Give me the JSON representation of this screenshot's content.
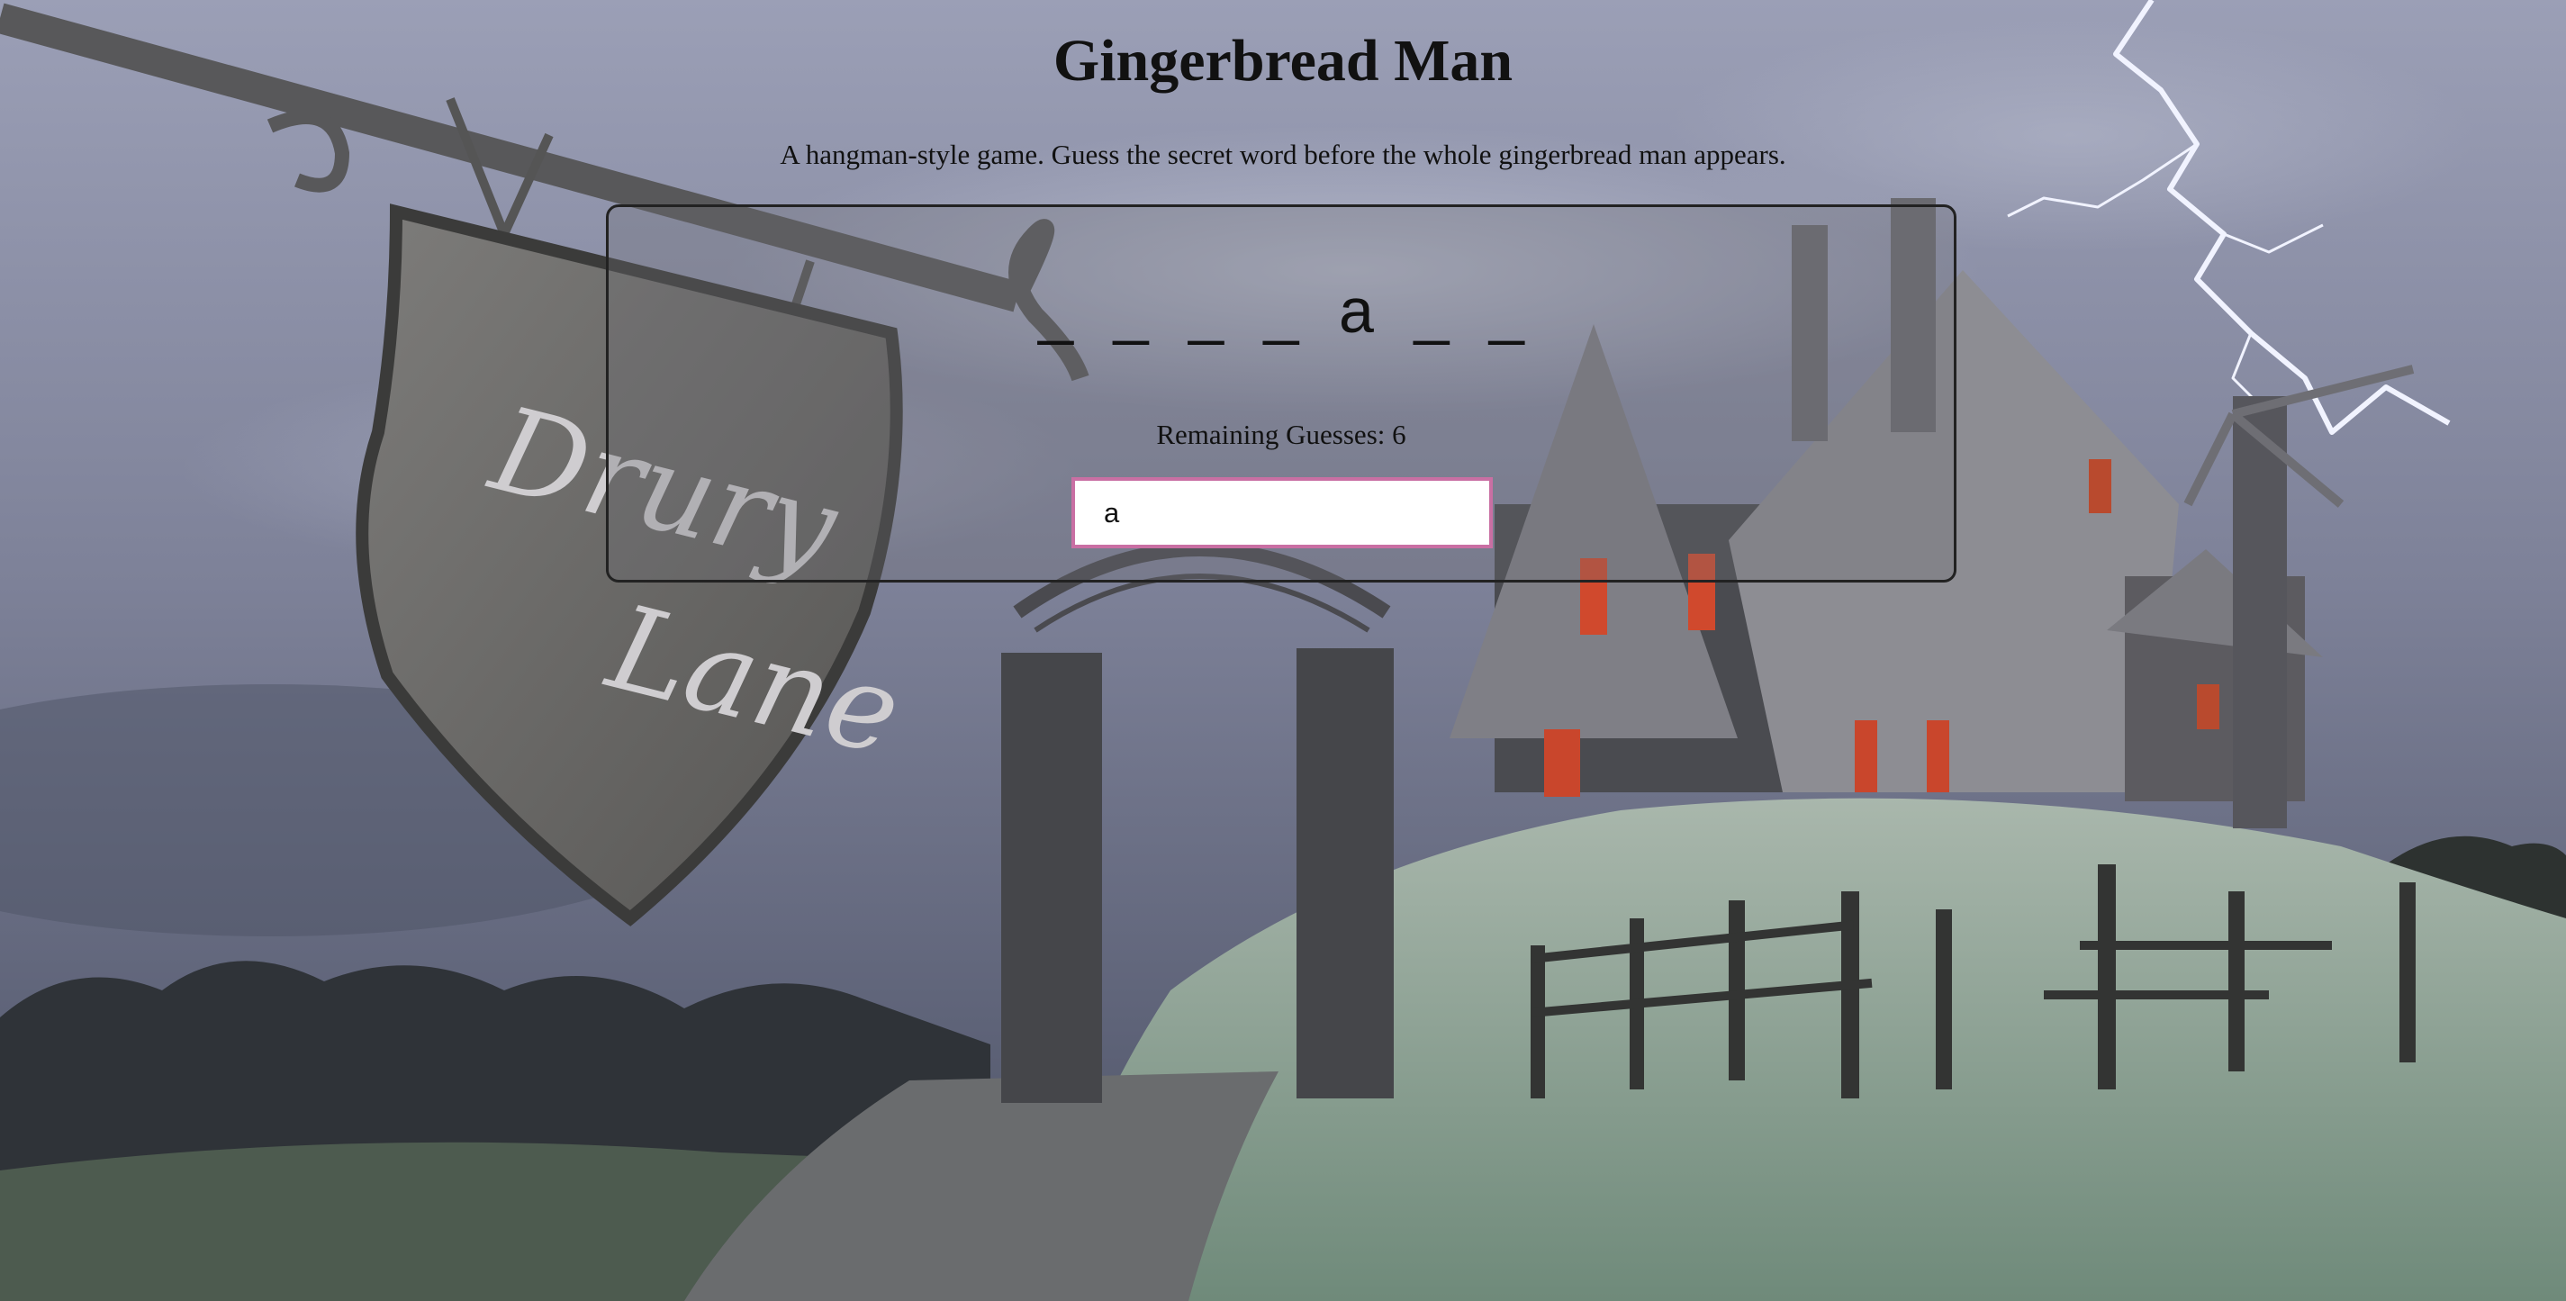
{
  "title": "Gingerbread Man",
  "subtitle": "A hangman-style game. Guess the secret word before the whole gingerbread man appears.",
  "word_display": [
    "_",
    "_",
    "_",
    "_",
    "a",
    "_",
    "_"
  ],
  "remaining_guesses_label": "Remaining Guesses: 6",
  "guess_input_value": "a",
  "background_scene": {
    "sign_text_line1": "Drury",
    "sign_text_line2": "Lane"
  },
  "colors": {
    "input_border": "#c96fa3",
    "sky": "#8a8fa8",
    "grass": "#8aa295"
  }
}
